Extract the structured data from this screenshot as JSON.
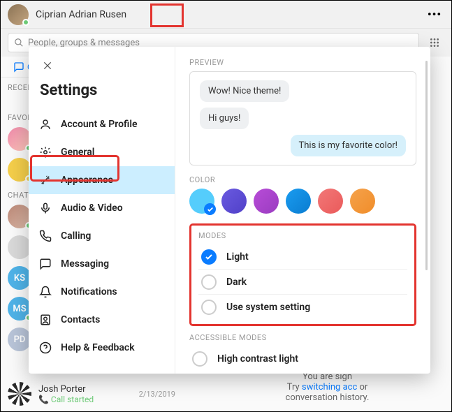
{
  "header": {
    "user_name": "Ciprian Adrian Rusen",
    "more_dots": "•••"
  },
  "search": {
    "placeholder": "People, groups & messages"
  },
  "tabs": {
    "chats": "Chat"
  },
  "sections": {
    "recent": "RECENT",
    "favorites": "FAVOR",
    "chats": "CHATS"
  },
  "bottom_contact": {
    "name": "Josh Porter",
    "sub": "📞 Call started",
    "date": "2/13/2019"
  },
  "right_hint": {
    "line1": "You are sign",
    "link": "switching acc",
    "prefix": "Try ",
    "line2_suffix": "or",
    "line3": "conversation history."
  },
  "avatars": {
    "ks": "KS",
    "ms": "MS",
    "pd": "PD"
  },
  "settings": {
    "title": "Settings",
    "nav": {
      "account": "Account & Profile",
      "general": "General",
      "appearance": "Appearance",
      "av": "Audio & Video",
      "calling": "Calling",
      "messaging": "Messaging",
      "notifications": "Notifications",
      "contacts": "Contacts",
      "help": "Help & Feedback"
    },
    "preview_label": "PREVIEW",
    "preview": {
      "msg1": "Wow! Nice theme!",
      "msg2": "Hi guys!",
      "msg3": "This is my favorite color!"
    },
    "color_label": "COLOR",
    "colors": [
      "#55cdfc",
      "#6a5ae0",
      "#b84cd8",
      "#1a9cf0",
      "#f27878",
      "#f5a24b"
    ],
    "modes_label": "MODES",
    "modes": {
      "light": "Light",
      "dark": "Dark",
      "system": "Use system setting"
    },
    "accessible_label": "ACCESSIBLE MODES",
    "accessible": {
      "hclight": "High contrast light"
    }
  }
}
